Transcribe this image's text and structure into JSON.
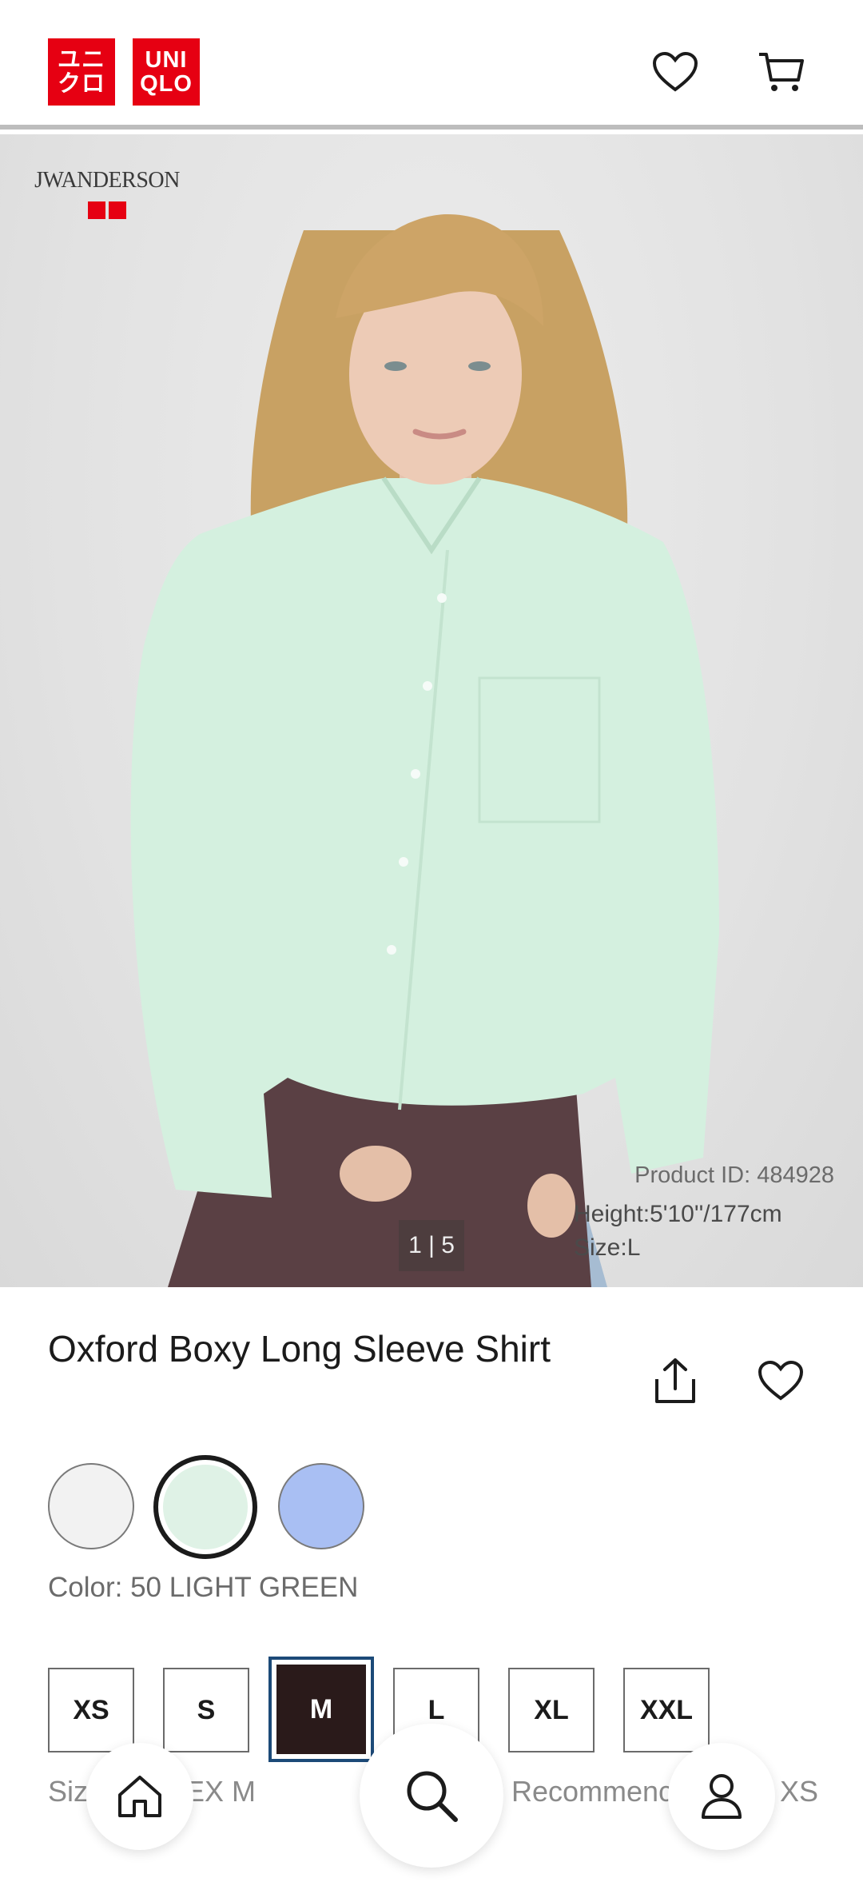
{
  "header": {
    "logo_top": "UNI",
    "logo_bottom": "QLO",
    "logo_kana_top": "ユニ",
    "logo_kana_bottom": "クロ",
    "wishlist_icon": "heart-icon",
    "cart_icon": "cart-icon"
  },
  "hero": {
    "brand": "JWANDERSON",
    "product_id": "Product ID: 484928",
    "model_height": "Height:5'10''/177cm",
    "model_size": "Size:L",
    "image_counter": "1 | 5"
  },
  "product": {
    "title": "Oxford Boxy Long Sleeve Shirt",
    "share_icon": "share-icon",
    "favorite_icon": "heart-icon",
    "color_label": "Color: 50 LIGHT GREEN",
    "swatches": [
      {
        "name": "white",
        "color": "#f2f2f2"
      },
      {
        "name": "light-green",
        "color": "#dff2e6",
        "selected": true
      },
      {
        "name": "light-blue",
        "color": "#a9bff3"
      }
    ],
    "sizes": [
      "XS",
      "S",
      "M",
      "L",
      "XL",
      "XXL"
    ],
    "selected_size": "M",
    "size_hint_left": "Siz",
    "size_hint_mid": "EX M",
    "size_hint_right": "Recommenc",
    "size_hint_end": "XS"
  },
  "nav": {
    "home_icon": "home-icon",
    "search_icon": "search-icon",
    "account_icon": "user-icon"
  },
  "colors": {
    "brand_red": "#e60012",
    "selected_size_bg": "#2a1a1a",
    "focus_border": "#1c4a78"
  }
}
